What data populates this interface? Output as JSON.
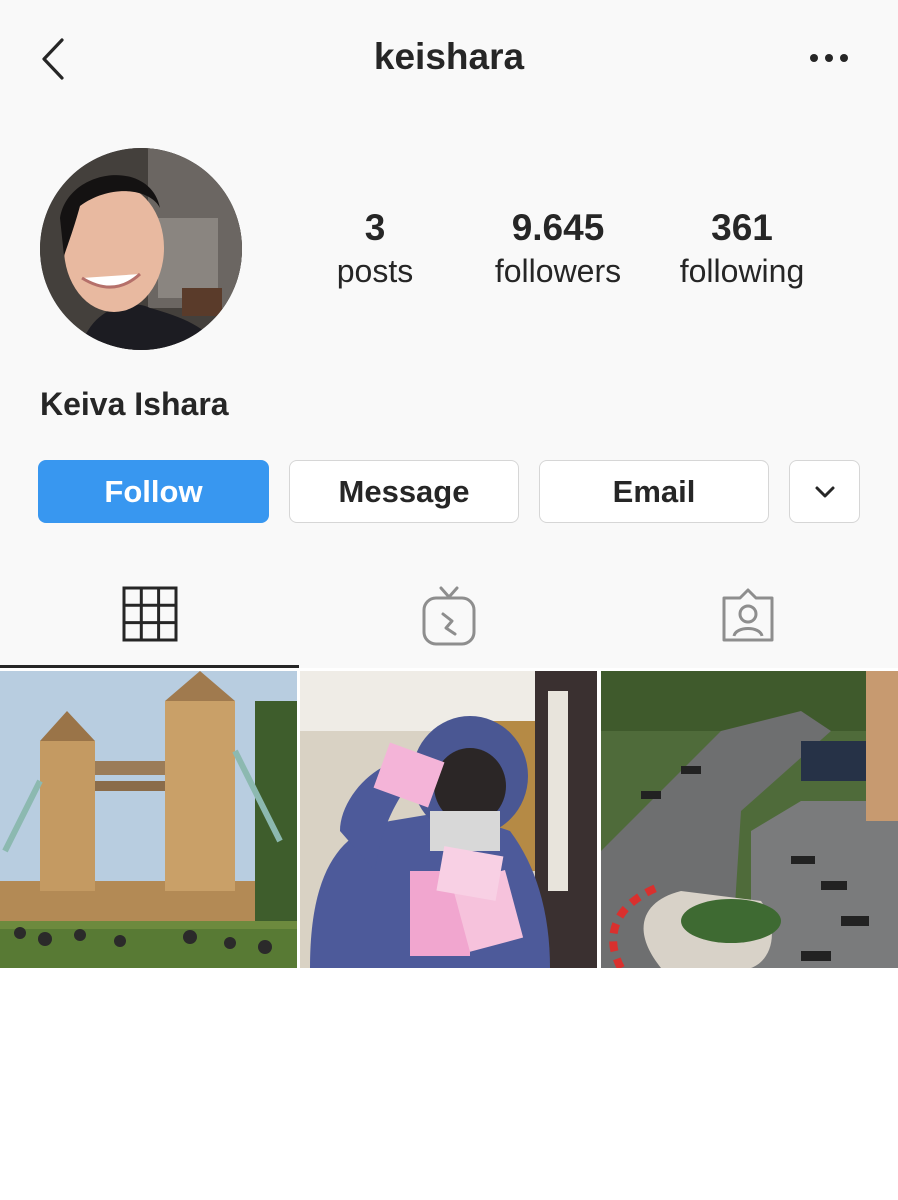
{
  "header": {
    "username": "keishara",
    "back_icon": "chevron-left-icon",
    "more_icon": "ellipsis-icon"
  },
  "profile": {
    "full_name": "Keiva Ishara",
    "stats": {
      "posts": {
        "value": "3",
        "label": "posts"
      },
      "followers": {
        "value": "9.645",
        "label": "followers"
      },
      "following": {
        "value": "361",
        "label": "following"
      }
    }
  },
  "actions": {
    "follow_label": "Follow",
    "message_label": "Message",
    "email_label": "Email",
    "more_icon": "chevron-down-icon"
  },
  "tabs": [
    {
      "icon": "grid-icon",
      "active": true
    },
    {
      "icon": "igtv-icon",
      "active": false
    },
    {
      "icon": "tagged-icon",
      "active": false
    }
  ],
  "posts": [
    {
      "subject": "Tower Bridge, London"
    },
    {
      "subject": "Person in hoodie holding toy boxes"
    },
    {
      "subject": "Monaco Grand Prix circuit"
    }
  ],
  "colors": {
    "accent": "#3897f0",
    "text": "#262626",
    "background": "#f9f9f9",
    "border": "#d6d6d6"
  }
}
